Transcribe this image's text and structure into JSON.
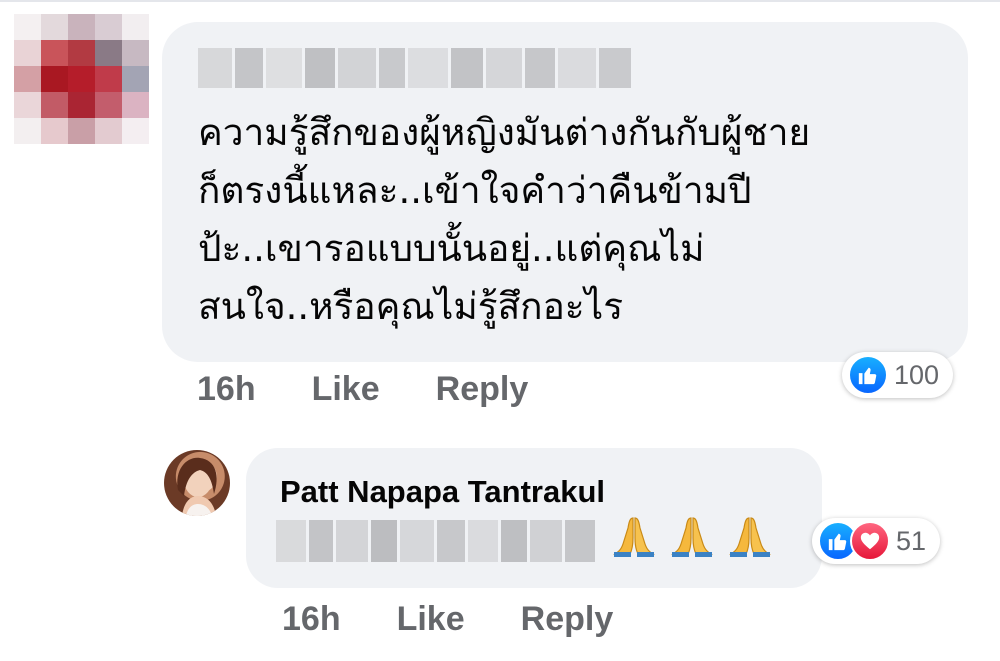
{
  "comments": [
    {
      "author": "",
      "text_lines": [
        "ความรู้สึกของผู้หญิงมันต่างกันกับผู้ชาย",
        "ก็ตรงนี้แหละ..เข้าใจคำว่าคืนข้ามปี",
        "ป้ะ..เขารอแบบนั้นอยู่..แต่คุณไม่",
        "สนใจ..หรือคุณไม่รู้สึกอะไร"
      ],
      "time": "16h",
      "like_label": "Like",
      "reply_label": "Reply",
      "reactions": [
        "like-icon"
      ],
      "reaction_count": "100"
    },
    {
      "author": "Patt Napapa Tantrakul",
      "text": "🙏🙏🙏",
      "time": "16h",
      "like_label": "Like",
      "reply_label": "Reply",
      "reactions": [
        "like-icon",
        "love-icon"
      ],
      "reaction_count": "51"
    }
  ],
  "colors": {
    "bubble": "#f0f2f5",
    "meta_text": "#65676b",
    "like_blue": "#0866ff",
    "love_red": "#e61739",
    "pray_emoji": "#f5b83d"
  }
}
